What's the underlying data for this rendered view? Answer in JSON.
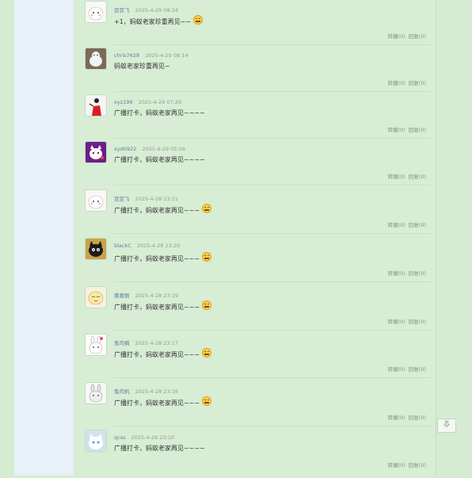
{
  "comments": [
    {
      "user": "豆豆飞",
      "time": "2025-4-29 08:34",
      "text": "+1，蚂蚁老家珍重再见~~",
      "emoji": true,
      "forward": "转播(0)",
      "reply": "回复(0)",
      "avatar": "white-bunny"
    },
    {
      "user": "chris7628",
      "time": "2025-4-29 08:14",
      "text": "蚂蚁老家珍重再见~",
      "emoji": false,
      "forward": "转播(0)",
      "reply": "回复(0)",
      "avatar": "white-ferret"
    },
    {
      "user": "xyz199",
      "time": "2025-4-29 07:29",
      "text": "广播打卡，蚂蚁老家再见~~~~",
      "emoji": false,
      "forward": "转播(0)",
      "reply": "回复(0)",
      "avatar": "red-figure"
    },
    {
      "user": "xyd0922",
      "time": "2025-4-29 05:56",
      "text": "广播打卡，蚂蚁老家再见~~~~",
      "emoji": false,
      "forward": "转播(0)",
      "reply": "回复(0)",
      "avatar": "purple-cat"
    },
    {
      "user": "豆豆飞",
      "time": "2025-4-28 23:21",
      "text": "广播打卡，蚂蚁老家再见~~~",
      "emoji": true,
      "forward": "转播(0)",
      "reply": "回复(0)",
      "avatar": "white-bunny"
    },
    {
      "user": "blackC",
      "time": "2025-4-28 23:20",
      "text": "广播打卡，蚂蚁老家再见~~~",
      "emoji": true,
      "forward": "转播(0)",
      "reply": "回复(0)",
      "avatar": "black-cat"
    },
    {
      "user": "喜喜丽",
      "time": "2025-4-28 23:19",
      "text": "广播打卡，蚂蚁老家再见~~~",
      "emoji": true,
      "forward": "转播(0)",
      "reply": "回复(0)",
      "avatar": "cream-cartoon"
    },
    {
      "user": "兔司楠",
      "time": "2025-4-28 23:17",
      "text": "广播打卡，蚂蚁老家再见~~~",
      "emoji": true,
      "forward": "转播(0)",
      "reply": "回复(0)",
      "avatar": "pink-bunny"
    },
    {
      "user": "兔司机",
      "time": "2025-4-28 23:16",
      "text": "广播打卡，蚂蚁老家再见~~~",
      "emoji": true,
      "forward": "转播(0)",
      "reply": "回复(0)",
      "avatar": "gray-bunny"
    },
    {
      "user": "qcss",
      "time": "2025-4-28 23:10",
      "text": "广播打卡，蚂蚁老家再见~~~~",
      "emoji": false,
      "forward": "转播(0)",
      "reply": "回复(0)",
      "avatar": "blue-kitten"
    }
  ],
  "back_to_top_icon": "back-to-top-icon",
  "colors": {
    "background": "#d5ecd2",
    "sidebar": "#e8f0f8",
    "username": "#5a7fa6",
    "meta": "#8aa38a"
  }
}
